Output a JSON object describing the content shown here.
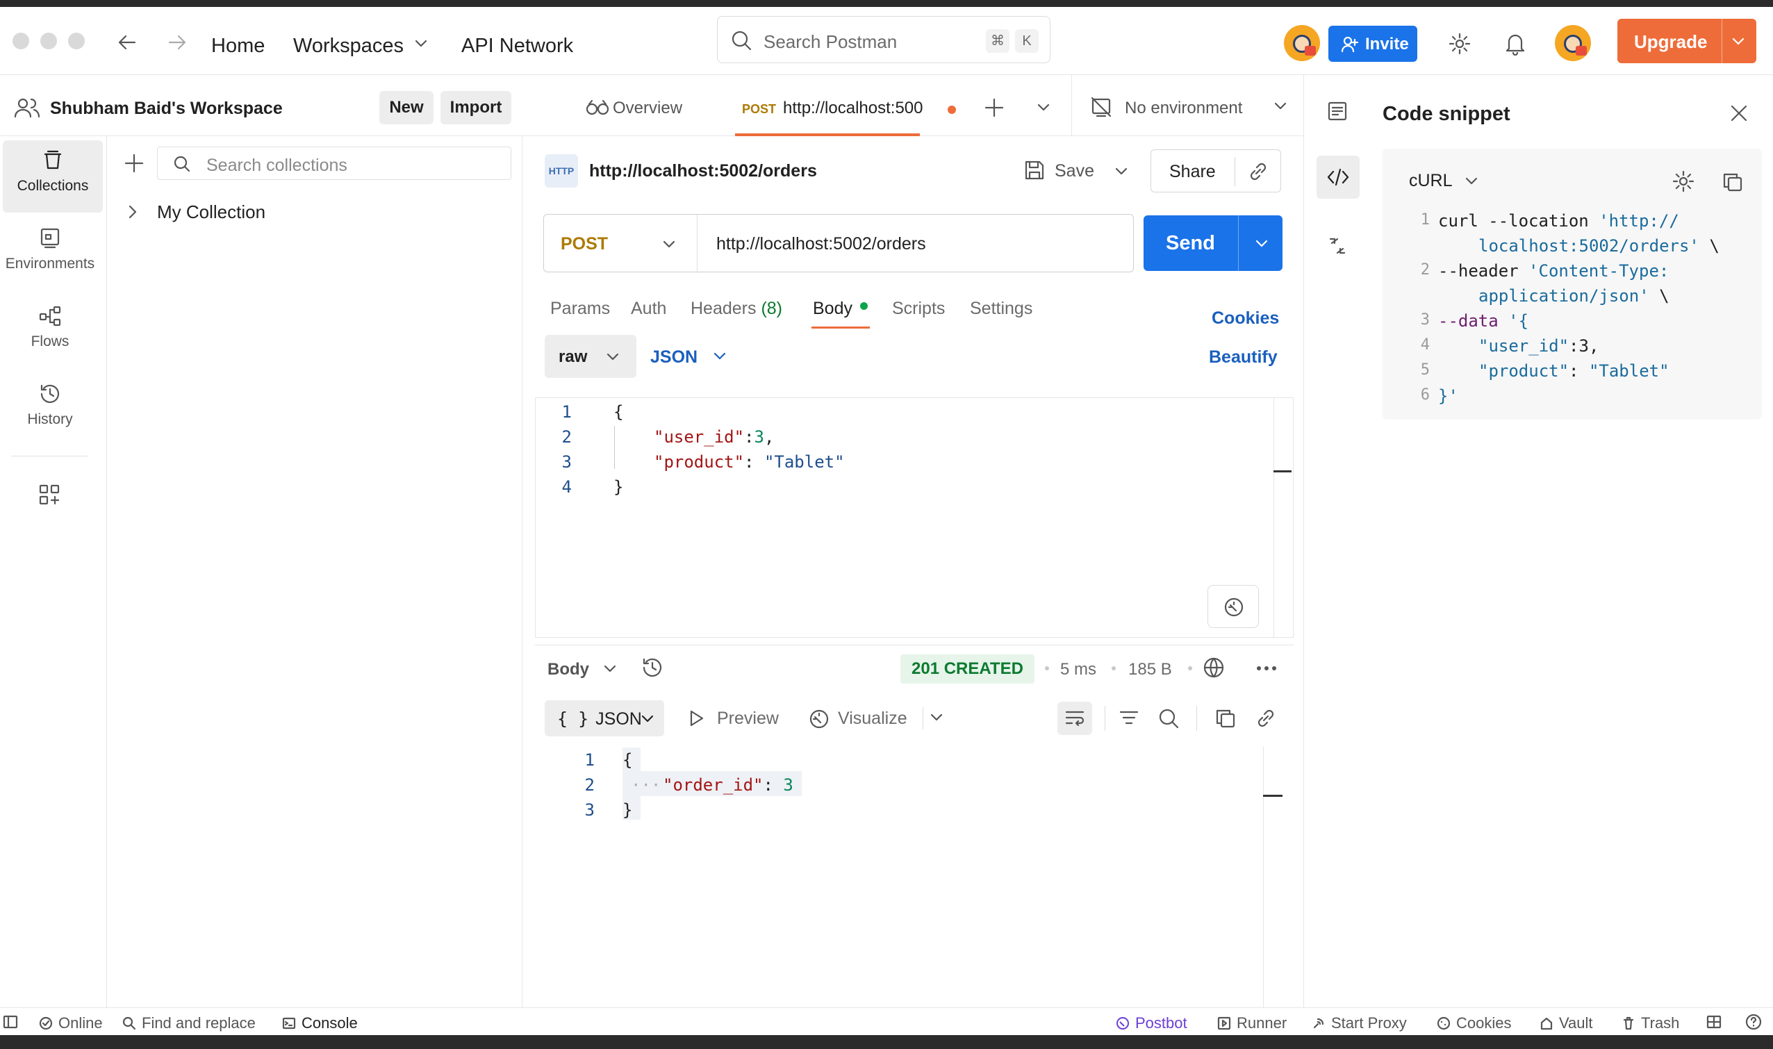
{
  "topbar": {
    "home": "Home",
    "workspaces": "Workspaces",
    "api_network": "API Network",
    "search_placeholder": "Search Postman",
    "shortcut_cmd": "⌘",
    "shortcut_key": "K",
    "invite": "Invite",
    "upgrade": "Upgrade"
  },
  "workspace": {
    "name": "Shubham Baid's Workspace",
    "new_label": "New",
    "import_label": "Import"
  },
  "rail": {
    "items": [
      {
        "label": "Collections",
        "icon": "collections-icon",
        "active": true
      },
      {
        "label": "Environments",
        "icon": "environments-icon"
      },
      {
        "label": "Flows",
        "icon": "flows-icon"
      },
      {
        "label": "History",
        "icon": "history-icon"
      }
    ]
  },
  "collections": {
    "search_placeholder": "Search collections",
    "items": [
      "My Collection"
    ]
  },
  "tabs": {
    "overview": "Overview",
    "active_method": "POST",
    "active_url": "http://localhost:500",
    "environment": "No environment"
  },
  "request": {
    "title": "http://localhost:5002/orders",
    "save": "Save",
    "share": "Share",
    "method": "POST",
    "url": "http://localhost:5002/orders",
    "send": "Send",
    "subtabs": {
      "params": "Params",
      "auth": "Auth",
      "headers": "Headers",
      "headers_count": "(8)",
      "body": "Body",
      "scripts": "Scripts",
      "settings": "Settings"
    },
    "cookies": "Cookies",
    "beautify": "Beautify",
    "body_mode": "raw",
    "body_lang": "JSON",
    "body_lines": [
      {
        "n": "1",
        "text": "{"
      },
      {
        "n": "2",
        "key": "\"user_id\"",
        "sep": ":",
        "val": "3",
        "end": ","
      },
      {
        "n": "3",
        "key": "\"product\"",
        "sep": ": ",
        "val": "\"Tablet\"",
        "end": ""
      },
      {
        "n": "4",
        "text": "}"
      }
    ]
  },
  "response": {
    "label": "Body",
    "status": "201 CREATED",
    "time": "5 ms",
    "size": "185 B",
    "format": "JSON",
    "preview": "Preview",
    "visualize": "Visualize",
    "lines": [
      {
        "n": "1",
        "text": "{"
      },
      {
        "n": "2",
        "key": "\"order_id\"",
        "sep": ": ",
        "val": "3"
      },
      {
        "n": "3",
        "text": "}"
      }
    ]
  },
  "snippet": {
    "title": "Code snippet",
    "language": "cURL",
    "lines": [
      {
        "n": "1",
        "a": "curl --location ",
        "b": "'http://"
      },
      {
        "n": "",
        "a": "",
        "b": "localhost:5002/orders'",
        "c": " \\"
      },
      {
        "n": "2",
        "a": "--header ",
        "b": "'Content-Type:"
      },
      {
        "n": "",
        "a": "",
        "b": "application/json'",
        "c": " \\"
      },
      {
        "n": "3",
        "a": "--data ",
        "b": "'{"
      },
      {
        "n": "4",
        "b": "\"user_id\"",
        "c": ":3,"
      },
      {
        "n": "5",
        "b": "\"product\"",
        "c": ": ",
        "d": "\"Tablet\""
      },
      {
        "n": "6",
        "a": "}'"
      }
    ]
  },
  "statusbar": {
    "online": "Online",
    "find_replace": "Find and replace",
    "console": "Console",
    "postbot": "Postbot",
    "runner": "Runner",
    "start_proxy": "Start Proxy",
    "cookies": "Cookies",
    "vault": "Vault",
    "trash": "Trash"
  },
  "colors": {
    "accent_orange": "#ee6c3a",
    "primary_blue": "#1a73e8",
    "post_method": "#ad7a03",
    "status_green": "#0c7a30"
  }
}
